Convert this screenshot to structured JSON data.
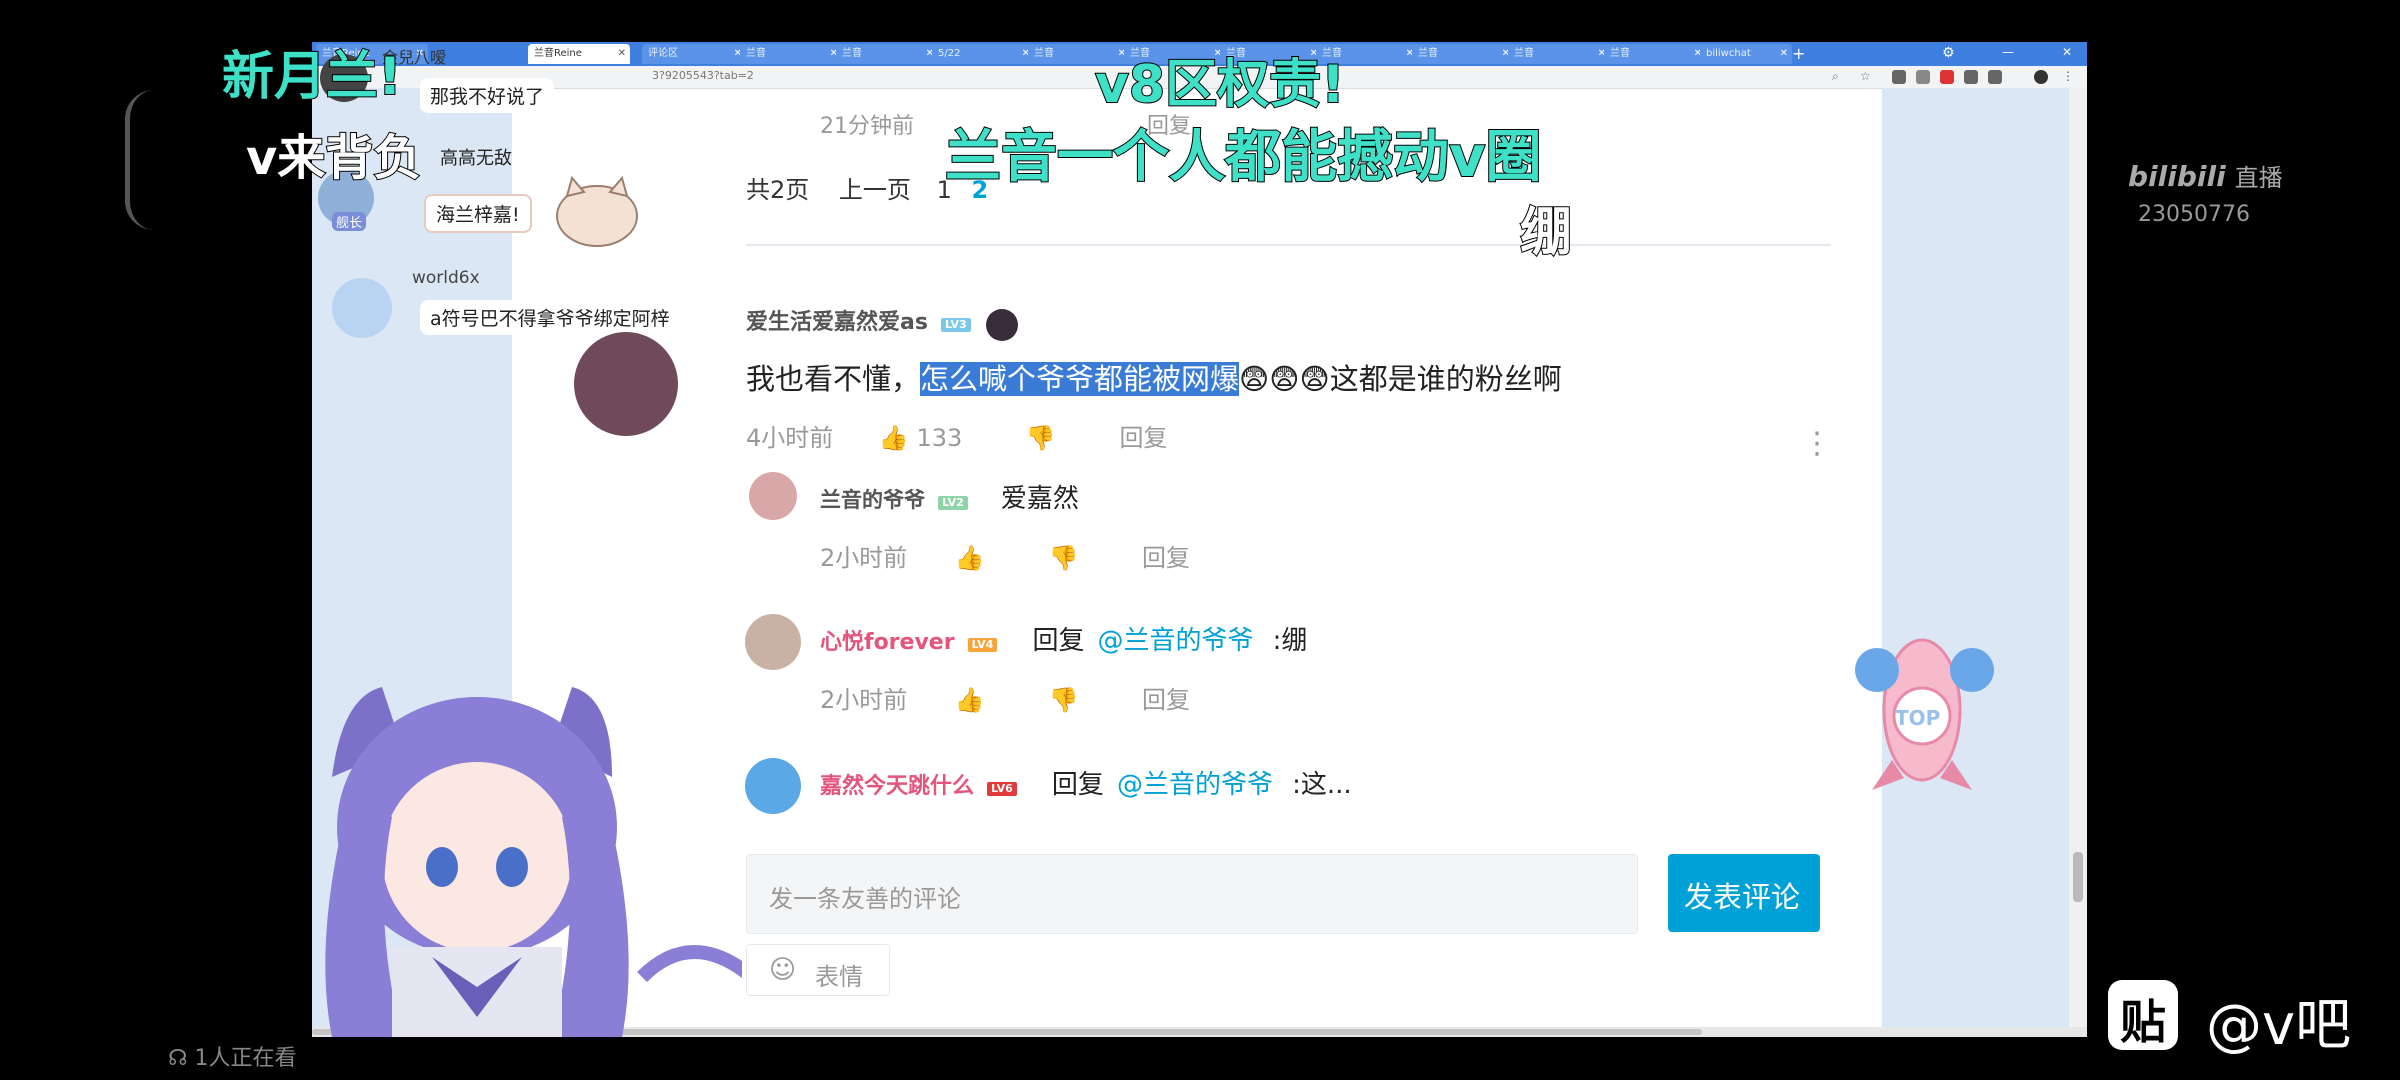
{
  "browser": {
    "tabs": [
      "兰音Reine",
      "兰音Reine",
      "评论区",
      "兰音",
      "兰音",
      "5/22",
      "兰音",
      "兰音",
      "兰音",
      "兰音",
      "兰音",
      "兰音",
      "兰音",
      "biliwchat"
    ],
    "active_tab_index": 1,
    "url": "3?9205543?tab=2",
    "new_tab": "+"
  },
  "chat": {
    "messages": [
      {
        "user": "金兒八嗳",
        "text": "那我不好说了"
      },
      {
        "user": "",
        "text": "高高无敌"
      },
      {
        "user": "",
        "text": "海兰梓嘉!"
      },
      {
        "user": "world6x",
        "text": "a符号巴不得拿爷爷绑定阿梓"
      }
    ],
    "badge": "舰长"
  },
  "comments_page": {
    "prev_time": "21分钟前",
    "prev_reply": "回复",
    "pagination": {
      "total": "共2页",
      "prev": "上一页",
      "pages": [
        "1",
        "2"
      ],
      "current": "2"
    },
    "main_comment": {
      "user": "爱生活爱嘉然爱as",
      "level": "LV3",
      "text_before": "我也看不懂，",
      "text_selected": "怎么喊个爷爷都能被网爆",
      "emoji": "😨😨😨",
      "text_after": "这都是谁的粉丝啊",
      "time": "4小时前",
      "likes": "133",
      "reply": "回复"
    },
    "replies": [
      {
        "user": "兰音的爷爷",
        "level": "LV2",
        "text": "爱嘉然",
        "time": "2小时前",
        "reply": "回复",
        "color": "#555555"
      },
      {
        "user": "心悦forever",
        "level": "LV4",
        "reply_prefix": "回复",
        "mention": "@兰音的爷爷",
        "text": ":绷",
        "time": "2小时前",
        "reply": "回复",
        "color": "#e4557d"
      },
      {
        "user": "嘉然今天跳什么",
        "level": "LV6",
        "reply_prefix": "回复",
        "mention": "@兰音的爷爷",
        "text": ":这...",
        "color": "#e4557d"
      }
    ],
    "comment_input": {
      "placeholder": "发一条友善的评论"
    },
    "submit": "发表评论",
    "emoji_btn": "表情",
    "top_btn": "TOP"
  },
  "overlay": {
    "subtitle_left_1": "新月兰!",
    "subtitle_left_2": "v来背负",
    "subtitle_center_1": "v8区权责!",
    "subtitle_center_2": "兰音一个人都能撼动v圈",
    "subtitle_center_3": "绷"
  },
  "bilibili": {
    "logo": "bilibili",
    "label": "直播",
    "room": "23050776"
  },
  "viewers": "1人正在看",
  "watermark": {
    "icon": "贴",
    "text": "@v吧"
  },
  "colors": {
    "accent": "#00a1d6",
    "tabbar": "#3f7fe0",
    "panel": "#dbe7f5",
    "subtitle_teal": "#3fe0c8",
    "selection": "#3a7bd5"
  }
}
